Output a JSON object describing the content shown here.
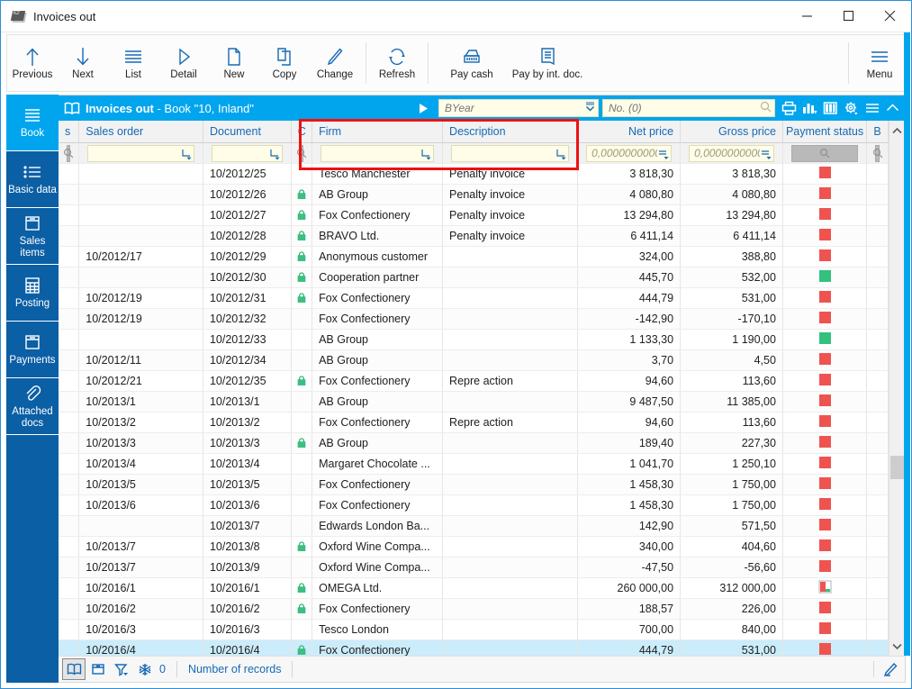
{
  "window": {
    "title": "Invoices out",
    "icon": "k2-app-icon",
    "controls": {
      "minimize": "minimize-icon",
      "maximize": "maximize-icon",
      "close": "close-icon"
    }
  },
  "ribbon": {
    "items": [
      {
        "label": "Previous",
        "icon": "arrow-up-icon"
      },
      {
        "label": "Next",
        "icon": "arrow-down-icon"
      },
      {
        "label": "List",
        "icon": "list-icon"
      },
      {
        "label": "Detail",
        "icon": "play-triangle-icon"
      },
      {
        "label": "New",
        "icon": "new-document-icon"
      },
      {
        "label": "Copy",
        "icon": "copy-icon"
      },
      {
        "label": "Change",
        "icon": "pencil-icon"
      },
      {
        "label": "Refresh",
        "icon": "refresh-icon"
      },
      {
        "label": "Pay cash",
        "icon": "cash-register-icon"
      },
      {
        "label": "Pay by int. doc.",
        "icon": "internal-document-icon"
      }
    ],
    "menu": {
      "label": "Menu",
      "icon": "hamburger-menu-icon"
    }
  },
  "sidebar": {
    "items": [
      {
        "label": "Book",
        "icon": "lines-icon",
        "active": true
      },
      {
        "label": "Basic data",
        "icon": "bullet-list-icon",
        "active": false
      },
      {
        "label": "Sales items",
        "icon": "box-icon",
        "active": false
      },
      {
        "label": "Posting",
        "icon": "calculator-icon",
        "active": false
      },
      {
        "label": "Payments",
        "icon": "box-icon",
        "active": false
      },
      {
        "label": "Attached docs",
        "icon": "paperclip-icon",
        "active": false
      }
    ]
  },
  "grid_header": {
    "book_icon": "open-book-icon",
    "title_main": "Invoices out",
    "title_rest": " - Book \"10, Inland\"",
    "expand_icon": "play-triangle-icon",
    "year_filter": {
      "value": "",
      "placeholder": "BYear",
      "dropdown_icon": "chevron-down-icon"
    },
    "number_search": {
      "value": "",
      "placeholder": "No. (0)",
      "icon": "search-icon"
    },
    "tools": [
      {
        "name": "print-icon"
      },
      {
        "name": "chart-icon"
      },
      {
        "name": "columns-icon"
      },
      {
        "name": "gear-icon"
      },
      {
        "name": "hamburger-menu-icon"
      },
      {
        "name": "chevron-up-icon"
      }
    ]
  },
  "table": {
    "columns": [
      {
        "key": "s",
        "label": "s",
        "align": "left",
        "filter": "magnifier"
      },
      {
        "key": "order",
        "label": "Sales order",
        "align": "left",
        "filter": "text"
      },
      {
        "key": "document",
        "label": "Document",
        "align": "left",
        "filter": "text"
      },
      {
        "key": "lock",
        "label": "C",
        "align": "center",
        "filter": "magnifier"
      },
      {
        "key": "firm",
        "label": "Firm",
        "align": "left",
        "filter": "text"
      },
      {
        "key": "desc",
        "label": "Description",
        "align": "left",
        "filter": "text"
      },
      {
        "key": "net",
        "label": "Net price",
        "align": "right",
        "filter": "num",
        "filter_value": "0,0000000000..."
      },
      {
        "key": "gross",
        "label": "Gross price",
        "align": "right",
        "filter": "num",
        "filter_value": "0,0000000000..."
      },
      {
        "key": "status",
        "label": "Payment status",
        "align": "center",
        "filter": "magnifier-gray"
      },
      {
        "key": "b",
        "label": "B",
        "align": "center",
        "filter": "magnifier-gray"
      }
    ],
    "rows": [
      {
        "s": "",
        "order": "",
        "document": "10/2012/25",
        "lock": false,
        "firm": "Tesco Manchester",
        "desc": "Penalty invoice",
        "net": "3 818,30",
        "gross": "3 818,30",
        "status": "red",
        "b": ""
      },
      {
        "s": "",
        "order": "",
        "document": "10/2012/26",
        "lock": true,
        "firm": "AB Group",
        "desc": "Penalty invoice",
        "net": "4 080,80",
        "gross": "4 080,80",
        "status": "red",
        "b": ""
      },
      {
        "s": "",
        "order": "",
        "document": "10/2012/27",
        "lock": true,
        "firm": "Fox Confectionery",
        "desc": "Penalty invoice",
        "net": "13 294,80",
        "gross": "13 294,80",
        "status": "red",
        "b": ""
      },
      {
        "s": "",
        "order": "",
        "document": "10/2012/28",
        "lock": true,
        "firm": "BRAVO Ltd.",
        "desc": "Penalty invoice",
        "net": "6 411,14",
        "gross": "6 411,14",
        "status": "red",
        "b": ""
      },
      {
        "s": "",
        "order": "10/2012/17",
        "document": "10/2012/29",
        "lock": true,
        "firm": "Anonymous customer",
        "desc": "",
        "net": "324,00",
        "gross": "388,80",
        "status": "red",
        "b": ""
      },
      {
        "s": "",
        "order": "",
        "document": "10/2012/30",
        "lock": true,
        "firm": "Cooperation partner",
        "desc": "",
        "net": "445,70",
        "gross": "532,00",
        "status": "green",
        "b": ""
      },
      {
        "s": "",
        "order": "10/2012/19",
        "document": "10/2012/31",
        "lock": true,
        "firm": "Fox Confectionery",
        "desc": "",
        "net": "444,79",
        "gross": "531,00",
        "status": "red",
        "b": ""
      },
      {
        "s": "",
        "order": "10/2012/19",
        "document": "10/2012/32",
        "lock": false,
        "firm": "Fox Confectionery",
        "desc": "",
        "net": "-142,90",
        "gross": "-170,10",
        "status": "red",
        "b": ""
      },
      {
        "s": "",
        "order": "",
        "document": "10/2012/33",
        "lock": false,
        "firm": "AB Group",
        "desc": "",
        "net": "1 133,30",
        "gross": "1 190,00",
        "status": "green",
        "b": ""
      },
      {
        "s": "",
        "order": "10/2012/11",
        "document": "10/2012/34",
        "lock": false,
        "firm": "AB Group",
        "desc": "",
        "net": "3,70",
        "gross": "4,50",
        "status": "red",
        "b": ""
      },
      {
        "s": "",
        "order": "10/2012/21",
        "document": "10/2012/35",
        "lock": true,
        "firm": "Fox Confectionery",
        "desc": "Repre action",
        "net": "94,60",
        "gross": "113,60",
        "status": "red",
        "b": ""
      },
      {
        "s": "",
        "order": "10/2013/1",
        "document": "10/2013/1",
        "lock": false,
        "firm": "AB Group",
        "desc": "",
        "net": "9 487,50",
        "gross": "11 385,00",
        "status": "red",
        "b": ""
      },
      {
        "s": "",
        "order": "10/2013/2",
        "document": "10/2013/2",
        "lock": false,
        "firm": "Fox Confectionery",
        "desc": "Repre action",
        "net": "94,60",
        "gross": "113,60",
        "status": "red",
        "b": ""
      },
      {
        "s": "",
        "order": "10/2013/3",
        "document": "10/2013/3",
        "lock": true,
        "firm": "AB Group",
        "desc": "",
        "net": "189,40",
        "gross": "227,30",
        "status": "red",
        "b": ""
      },
      {
        "s": "",
        "order": "10/2013/4",
        "document": "10/2013/4",
        "lock": false,
        "firm": "Margaret Chocolate ...",
        "desc": "",
        "net": "1 041,70",
        "gross": "1 250,10",
        "status": "red",
        "b": ""
      },
      {
        "s": "",
        "order": "10/2013/5",
        "document": "10/2013/5",
        "lock": false,
        "firm": "Fox Confectionery",
        "desc": "",
        "net": "1 458,30",
        "gross": "1 750,00",
        "status": "red",
        "b": ""
      },
      {
        "s": "",
        "order": "10/2013/6",
        "document": "10/2013/6",
        "lock": false,
        "firm": "Fox Confectionery",
        "desc": "",
        "net": "1 458,30",
        "gross": "1 750,00",
        "status": "red",
        "b": ""
      },
      {
        "s": "",
        "order": "",
        "document": "10/2013/7",
        "lock": false,
        "firm": "Edwards London Ba...",
        "desc": "",
        "net": "142,90",
        "gross": "571,50",
        "status": "red",
        "b": ""
      },
      {
        "s": "",
        "order": "10/2013/7",
        "document": "10/2013/8",
        "lock": true,
        "firm": "Oxford Wine Compa...",
        "desc": "",
        "net": "340,00",
        "gross": "404,60",
        "status": "red",
        "b": ""
      },
      {
        "s": "",
        "order": "10/2013/7",
        "document": "10/2013/9",
        "lock": false,
        "firm": "Oxford Wine Compa...",
        "desc": "",
        "net": "-47,50",
        "gross": "-56,60",
        "status": "red",
        "b": ""
      },
      {
        "s": "",
        "order": "10/2016/1",
        "document": "10/2016/1",
        "lock": true,
        "firm": "OMEGA Ltd.",
        "desc": "",
        "net": "260 000,00",
        "gross": "312 000,00",
        "status": "partial",
        "b": ""
      },
      {
        "s": "",
        "order": "10/2016/2",
        "document": "10/2016/2",
        "lock": true,
        "firm": "Fox Confectionery",
        "desc": "",
        "net": "188,57",
        "gross": "226,00",
        "status": "red",
        "b": ""
      },
      {
        "s": "",
        "order": "10/2016/3",
        "document": "10/2016/3",
        "lock": false,
        "firm": "Tesco London",
        "desc": "",
        "net": "700,00",
        "gross": "840,00",
        "status": "red",
        "b": ""
      },
      {
        "s": "",
        "order": "10/2016/4",
        "document": "10/2016/4",
        "lock": true,
        "firm": "Fox Confectionery",
        "desc": "",
        "net": "444,79",
        "gross": "531,00",
        "status": "red",
        "b": "",
        "selected": true
      }
    ]
  },
  "statusbar": {
    "buttons": [
      {
        "name": "book-view-button",
        "icon": "open-book-icon",
        "pressed": true
      },
      {
        "name": "archive-button",
        "icon": "archive-box-icon",
        "pressed": false
      },
      {
        "name": "filter-button",
        "icon": "funnel-icon",
        "pressed": false
      },
      {
        "name": "snowflake-button",
        "icon": "snowflake-icon",
        "pressed": false
      }
    ],
    "count": "0",
    "records_label": "Number of records",
    "edit_icon": "pencil-icon"
  },
  "colors": {
    "accent": "#00a5ee",
    "nav": "#0b5fa5",
    "icon_blue": "#1669b5",
    "status_red": "#ef5350",
    "status_green": "#33c17e",
    "selection": "#cbecfa",
    "filter_yellow": "#fffde7",
    "annotation_red": "#ee1111"
  }
}
